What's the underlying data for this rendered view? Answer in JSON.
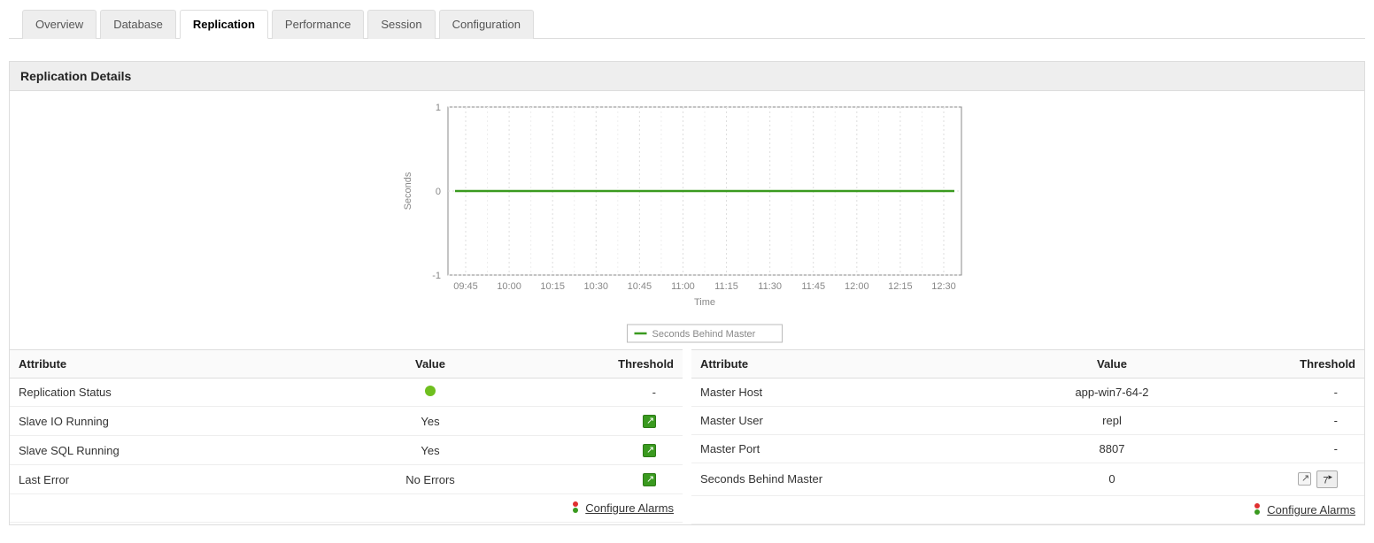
{
  "tabs": [
    {
      "label": "Overview",
      "active": false
    },
    {
      "label": "Database",
      "active": false
    },
    {
      "label": "Replication",
      "active": true
    },
    {
      "label": "Performance",
      "active": false
    },
    {
      "label": "Session",
      "active": false
    },
    {
      "label": "Configuration",
      "active": false
    }
  ],
  "panel_title": "Replication Details",
  "chart_data": {
    "type": "line",
    "title": "",
    "xlabel": "Time",
    "ylabel": "Seconds",
    "ylim": [
      -1,
      1
    ],
    "categories": [
      "09:45",
      "10:00",
      "10:15",
      "10:30",
      "10:45",
      "11:00",
      "11:15",
      "11:30",
      "11:45",
      "12:00",
      "12:15",
      "12:30"
    ],
    "series": [
      {
        "name": "Seconds Behind Master",
        "values": [
          0,
          0,
          0,
          0,
          0,
          0,
          0,
          0,
          0,
          0,
          0,
          0
        ],
        "color": "#3a9a1f"
      }
    ]
  },
  "columns": {
    "attr": "Attribute",
    "val": "Value",
    "thr": "Threshold"
  },
  "left_rows": [
    {
      "attr": "Replication Status",
      "value": "",
      "status_dot": true,
      "threshold": "-",
      "threshold_icon": null
    },
    {
      "attr": "Slave IO Running",
      "value": "Yes",
      "threshold": "",
      "threshold_icon": "green"
    },
    {
      "attr": "Slave SQL Running",
      "value": "Yes",
      "threshold": "",
      "threshold_icon": "green"
    },
    {
      "attr": "Last Error",
      "value": "No Errors",
      "threshold": "",
      "threshold_icon": "green"
    }
  ],
  "right_rows": [
    {
      "attr": "Master Host",
      "value": "app-win7-64-2",
      "threshold": "-",
      "threshold_icon": null
    },
    {
      "attr": "Master User",
      "value": "repl",
      "threshold": "-",
      "threshold_icon": null
    },
    {
      "attr": "Master Port",
      "value": "8807",
      "threshold": "-",
      "threshold_icon": null
    },
    {
      "attr": "Seconds Behind Master",
      "value": "0",
      "threshold": "",
      "threshold_icon": "plain",
      "threshold_badge": "7"
    }
  ],
  "configure_alarms": "Configure Alarms"
}
